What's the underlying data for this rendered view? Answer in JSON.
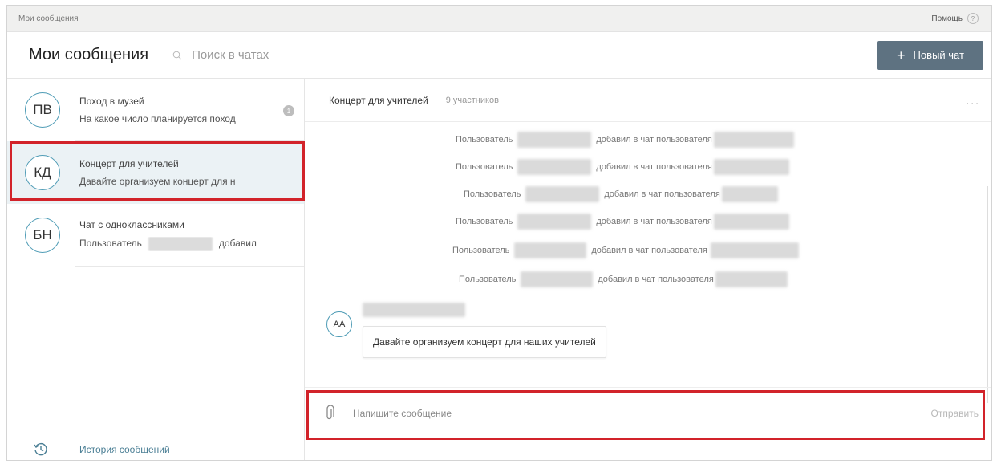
{
  "topbar": {
    "title": "Мои сообщения",
    "help_label": "Помощь",
    "help_icon": "?"
  },
  "header": {
    "title": "Мои сообщения",
    "search_placeholder": "Поиск в чатах",
    "new_chat_label": "Новый чат",
    "new_chat_icon": "+"
  },
  "sidebar": {
    "chats": [
      {
        "initials": "ПВ",
        "name": "Поход в музей",
        "preview": "На какое число планируется поход",
        "unread": "1"
      },
      {
        "initials": "КД",
        "name": "Концерт для учителей",
        "preview": "Давайте организуем концерт для н"
      },
      {
        "initials": "БН",
        "name": "Чат с одноклассниками",
        "preview_left": "Пользователь",
        "preview_right": "добавил"
      }
    ],
    "history_label": "История сообщений"
  },
  "chat": {
    "title": "Концерт для учителей",
    "participants": "9 участников",
    "more_icon": "...",
    "system_messages": [
      {
        "left": "Пользователь",
        "right": "добавил в чат пользователя"
      },
      {
        "left": "Пользователь",
        "right": "добавил в чат пользователя"
      },
      {
        "left": "Пользователь",
        "right": "добавил в чат пользователя"
      },
      {
        "left": "Пользователь",
        "right": "добавил в чат пользователя"
      },
      {
        "left": "Пользователь",
        "right": "добавил в чат пользователя"
      },
      {
        "left": "Пользователь",
        "right": "добавил в чат пользователя"
      }
    ],
    "message": {
      "avatar": "АА",
      "text": "Давайте организуем концерт для наших учителей"
    }
  },
  "composer": {
    "placeholder": "Напишите сообщение",
    "send_label": "Отправить"
  },
  "colors": {
    "accent": "#5e7281",
    "highlight": "#d2232a",
    "avatar_border": "#4d9bb5",
    "active_bg": "#ebf2f5"
  }
}
